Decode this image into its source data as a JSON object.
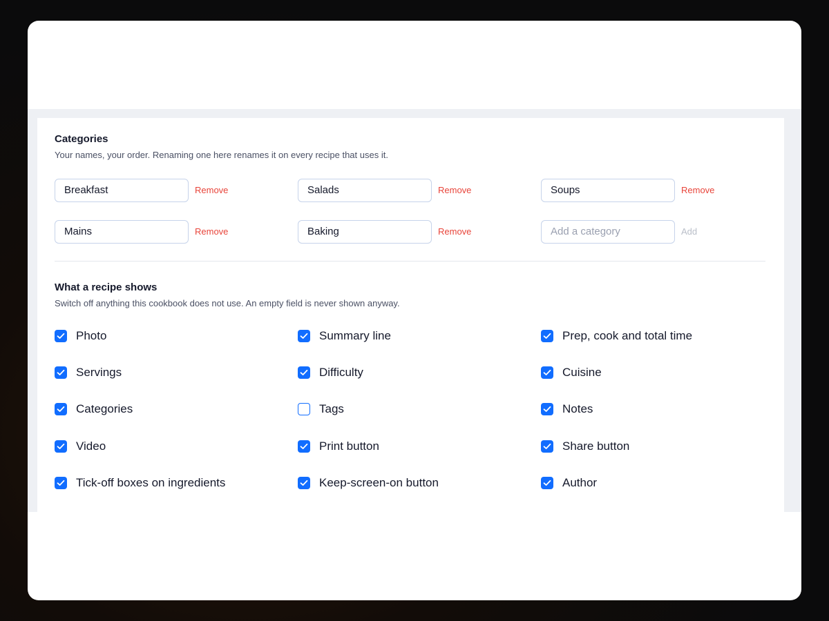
{
  "categories_section": {
    "title": "Categories",
    "subtitle": "Your names, your order. Renaming one here renames it on every recipe that uses it.",
    "items": [
      {
        "value": "Breakfast",
        "remove_label": "Remove"
      },
      {
        "value": "Salads",
        "remove_label": "Remove"
      },
      {
        "value": "Soups",
        "remove_label": "Remove"
      },
      {
        "value": "Mains",
        "remove_label": "Remove"
      },
      {
        "value": "Baking",
        "remove_label": "Remove"
      }
    ],
    "new_category": {
      "placeholder": "Add a category",
      "add_label": "Add"
    }
  },
  "recipe_fields_section": {
    "title": "What a recipe shows",
    "subtitle": "Switch off anything this cookbook does not use. An empty field is never shown anyway.",
    "options": [
      {
        "label": "Photo",
        "checked": true
      },
      {
        "label": "Summary line",
        "checked": true
      },
      {
        "label": "Prep, cook and total time",
        "checked": true
      },
      {
        "label": "Servings",
        "checked": true
      },
      {
        "label": "Difficulty",
        "checked": true
      },
      {
        "label": "Cuisine",
        "checked": true
      },
      {
        "label": "Categories",
        "checked": true
      },
      {
        "label": "Tags",
        "checked": false
      },
      {
        "label": "Notes",
        "checked": true
      },
      {
        "label": "Video",
        "checked": true
      },
      {
        "label": "Print button",
        "checked": true
      },
      {
        "label": "Share button",
        "checked": true
      },
      {
        "label": "Tick-off boxes on ingredients",
        "checked": true
      },
      {
        "label": "Keep-screen-on button",
        "checked": true
      },
      {
        "label": "Author",
        "checked": true
      }
    ]
  },
  "colors": {
    "accent": "#116dff",
    "remove": "#e8443a",
    "text": "#15192b",
    "muted": "#4a5064",
    "panel_bg": "#eef0f4"
  }
}
